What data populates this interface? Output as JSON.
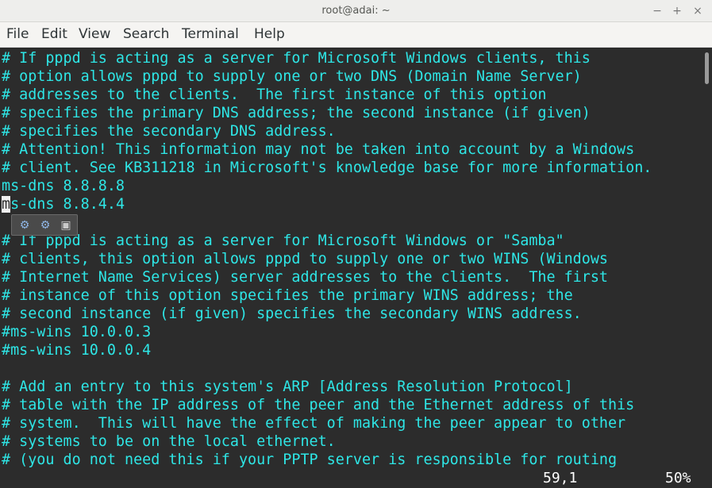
{
  "window": {
    "title": "root@adai: ~",
    "minimize": "−",
    "maximize": "+",
    "close": "×"
  },
  "menu": [
    "File",
    "Edit",
    "View",
    "Search",
    "Terminal",
    "Help"
  ],
  "terminal": {
    "lines": [
      "# If pppd is acting as a server for Microsoft Windows clients, this",
      "# option allows pppd to supply one or two DNS (Domain Name Server)",
      "# addresses to the clients.  The first instance of this option",
      "# specifies the primary DNS address; the second instance (if given)",
      "# specifies the secondary DNS address.",
      "# Attention! This information may not be taken into account by a Windows",
      "# client. See KB311218 in Microsoft's knowledge base for more information.",
      "ms-dns 8.8.8.8",
      "ms-dns 8.8.4.4",
      "",
      "# If pppd is acting as a server for Microsoft Windows or \"Samba\"",
      "# clients, this option allows pppd to supply one or two WINS (Windows",
      "# Internet Name Services) server addresses to the clients.  The first",
      "# instance of this option specifies the primary WINS address; the",
      "# second instance (if given) specifies the secondary WINS address.",
      "#ms-wins 10.0.0.3",
      "#ms-wins 10.0.0.4",
      "",
      "# Add an entry to this system's ARP [Address Resolution Protocol]",
      "# table with the IP address of the peer and the Ethernet address of this",
      "# system.  This will have the effect of making the peer appear to other",
      "# systems to be on the local ethernet.",
      "# (you do not need this if your PPTP server is responsible for routing"
    ],
    "cursor_line_index": 8,
    "cursor_char": "m",
    "cursor_rest": "s-dns 8.8.4.4"
  },
  "status": {
    "position": "59,1",
    "percent": "50%"
  },
  "mini_toolbar_icons": [
    "gear-icon",
    "gear-icon",
    "save-icon"
  ],
  "scroll": {
    "position_fraction": 0.5
  },
  "colors": {
    "text": "#2ee6e6",
    "background": "#2c2c2c",
    "status_text": "#ffffff"
  }
}
